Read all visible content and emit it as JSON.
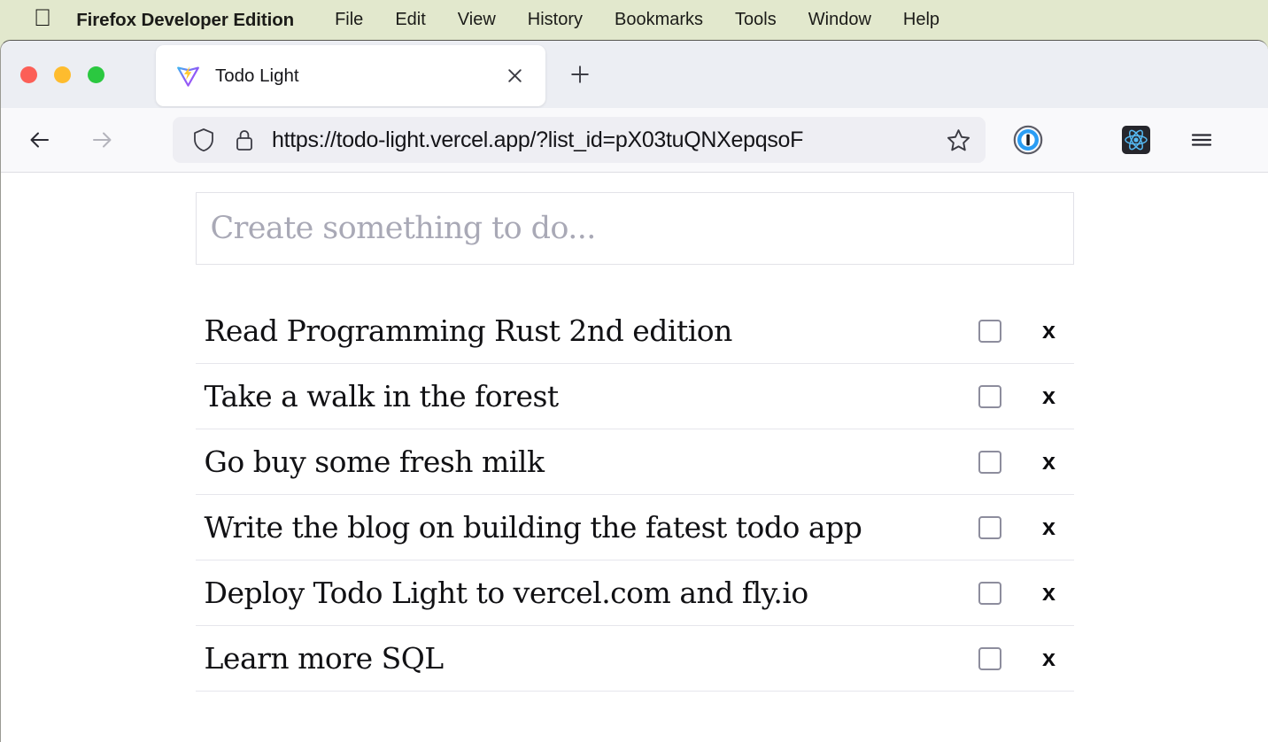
{
  "menubar": {
    "apple_logo": "",
    "app_name": "Firefox Developer Edition",
    "items": [
      {
        "label": "File"
      },
      {
        "label": "Edit"
      },
      {
        "label": "View"
      },
      {
        "label": "History"
      },
      {
        "label": "Bookmarks"
      },
      {
        "label": "Tools"
      },
      {
        "label": "Window"
      },
      {
        "label": "Help"
      }
    ],
    "background_color": "#e2e8cd"
  },
  "window_controls": {
    "close_color": "#fc5f57",
    "minimize_color": "#febc2e",
    "maximize_color": "#2bc840"
  },
  "tab_strip": {
    "tab": {
      "title": "Todo Light",
      "favicon": "vite-logo-icon",
      "close_label": "×"
    },
    "new_tab_label": "+"
  },
  "nav_toolbar": {
    "back_label": "←",
    "forward_label": "→",
    "url": "https://todo-light.vercel.app/?list_id=pX03tuQNXepqsoF",
    "shield_icon": "shield-icon",
    "lock_icon": "lock-icon",
    "bookmark_icon": "star-icon",
    "extensions": [
      {
        "name": "1password-icon"
      },
      {
        "name": "react-devtools-icon"
      }
    ],
    "menu_icon": "hamburger-icon"
  },
  "todo_app": {
    "input_placeholder": "Create something to do...",
    "input_value": "",
    "checkbox_border_color": "#8d8d9d",
    "delete_label": "x",
    "items": [
      {
        "label": "Read Programming Rust 2nd edition",
        "checked": false
      },
      {
        "label": "Take a walk in the forest",
        "checked": false
      },
      {
        "label": "Go buy some fresh milk",
        "checked": false
      },
      {
        "label": "Write the blog on building the fatest todo app",
        "checked": false
      },
      {
        "label": "Deploy Todo Light to vercel.com and fly.io",
        "checked": false
      },
      {
        "label": "Learn more SQL",
        "checked": false
      }
    ]
  }
}
